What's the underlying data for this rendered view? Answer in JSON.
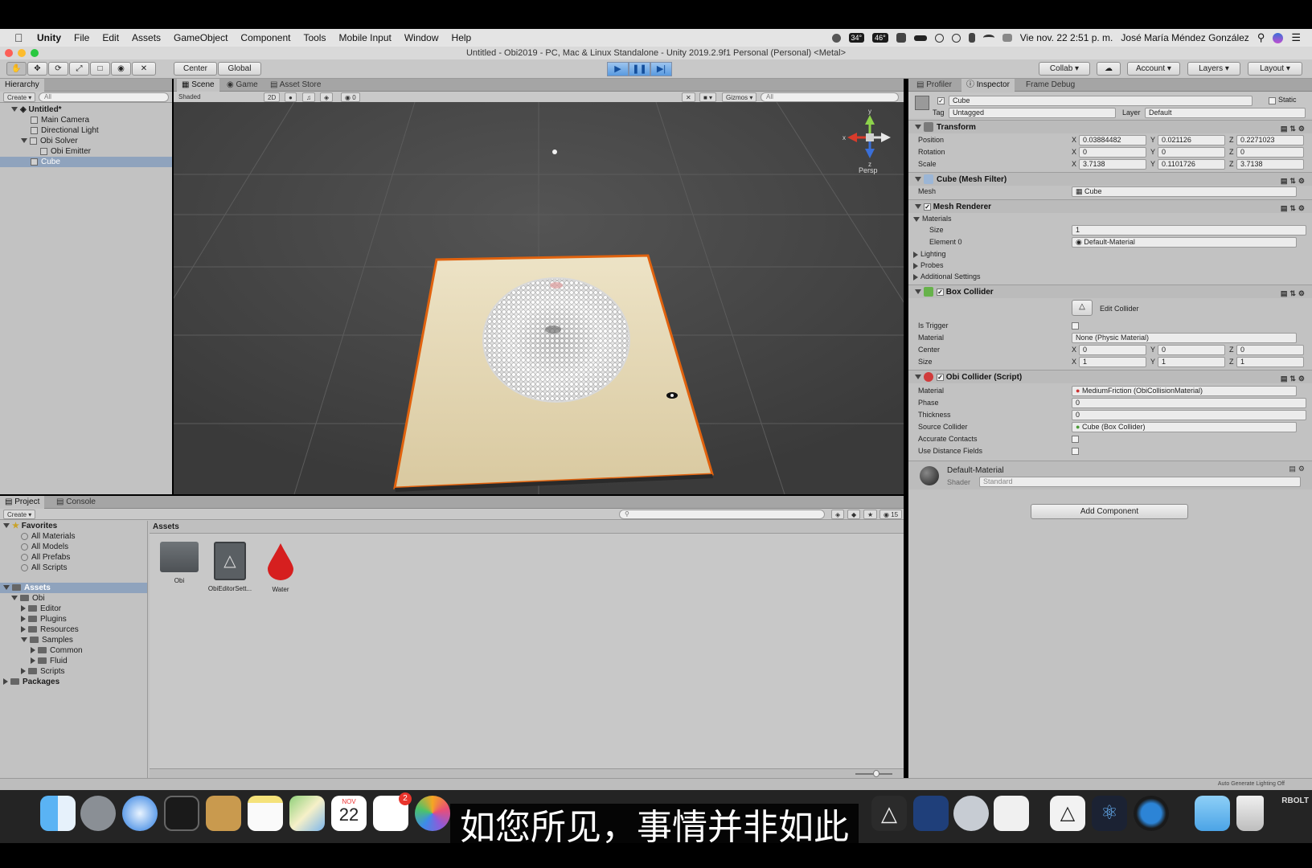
{
  "menubar": {
    "app": "Unity",
    "items": [
      "File",
      "Edit",
      "Assets",
      "GameObject",
      "Component",
      "Tools",
      "Mobile Input",
      "Window",
      "Help"
    ],
    "status_cpu": "34°",
    "status_gpu": "46°",
    "datetime": "Vie nov. 22  2:51 p. m.",
    "user": "José María Méndez González"
  },
  "window": {
    "title": "Untitled - Obi2019 - PC, Mac & Linux Standalone - Unity 2019.2.9f1 Personal (Personal) <Metal>"
  },
  "toolbar": {
    "pivot": "Center",
    "space": "Global",
    "collab": "Collab",
    "account": "Account",
    "layers": "Layers",
    "layout": "Layout"
  },
  "hierarchy": {
    "tab": "Hierarchy",
    "create": "Create",
    "search_placeholder": "All",
    "scene": "Untitled*",
    "items": [
      "Main Camera",
      "Directional Light",
      "Obi Solver",
      "Obi Emitter",
      "Cube"
    ]
  },
  "scene_view": {
    "tabs": [
      "Scene",
      "Game",
      "Asset Store"
    ],
    "shading": "Shaded",
    "mode_2d": "2D",
    "gizmos": "Gizmos",
    "search_placeholder": "All",
    "fx_count": "0",
    "persp": "Persp",
    "axis_y": "y",
    "axis_x": "x",
    "axis_z": "z"
  },
  "inspector": {
    "tabs": [
      "Profiler",
      "Inspector",
      "Frame Debug"
    ],
    "name": "Cube",
    "static": "Static",
    "tag_label": "Tag",
    "tag": "Untagged",
    "layer_label": "Layer",
    "layer": "Default",
    "transform": {
      "title": "Transform",
      "position_label": "Position",
      "rotation_label": "Rotation",
      "scale_label": "Scale",
      "position": [
        "0.03884482",
        "0.021126",
        "0.2271023"
      ],
      "rotation": [
        "0",
        "0",
        "0"
      ],
      "scale": [
        "3.7138",
        "0.1101726",
        "3.7138"
      ]
    },
    "mesh_filter": {
      "title": "Cube (Mesh Filter)",
      "mesh_label": "Mesh",
      "mesh": "Cube"
    },
    "mesh_renderer": {
      "title": "Mesh Renderer",
      "materials": "Materials",
      "size_label": "Size",
      "size": "1",
      "element_label": "Element 0",
      "element": "Default-Material",
      "lighting": "Lighting",
      "probes": "Probes",
      "additional": "Additional Settings"
    },
    "box_collider": {
      "title": "Box Collider",
      "edit": "Edit Collider",
      "trigger_label": "Is Trigger",
      "material_label": "Material",
      "material": "None (Physic Material)",
      "center_label": "Center",
      "center": [
        "0",
        "0",
        "0"
      ],
      "size_label": "Size",
      "size": [
        "1",
        "1",
        "1"
      ]
    },
    "obi_collider": {
      "title": "Obi Collider (Script)",
      "material_label": "Material",
      "material": "MediumFriction (ObiCollisionMaterial)",
      "phase_label": "Phase",
      "phase": "0",
      "thickness_label": "Thickness",
      "thickness": "0",
      "source_label": "Source Collider",
      "source": "Cube (Box Collider)",
      "accurate_label": "Accurate Contacts",
      "distance_label": "Use Distance Fields"
    },
    "material": {
      "name": "Default-Material",
      "shader_label": "Shader",
      "shader": "Standard"
    },
    "add_component": "Add Component"
  },
  "project": {
    "tabs": [
      "Project",
      "Console"
    ],
    "create": "Create",
    "favorites": "Favorites",
    "fav_items": [
      "All Materials",
      "All Models",
      "All Prefabs",
      "All Scripts"
    ],
    "assets_root": "Assets",
    "tree": [
      "Obi",
      "Editor",
      "Plugins",
      "Resources",
      "Samples",
      "Common",
      "Fluid",
      "Scripts"
    ],
    "packages": "Packages",
    "breadcrumb": "Assets",
    "asset_items": [
      "Obi",
      "ObiEditorSett...",
      "Water"
    ],
    "layer_count": "15"
  },
  "statusbar": {
    "text": "Auto Generate Lighting Off"
  },
  "dock": {
    "calendar_month": "NOV",
    "calendar_day": "22",
    "reminders_badge": "2",
    "right_text": "RBOLT"
  },
  "subtitle": "如您所见，事情并非如此",
  "colors": {
    "accent": "#5a9ae0",
    "selection": "#8fa3bd",
    "panel": "#c2c2c2",
    "scene_bg": "#4a4a4a"
  }
}
